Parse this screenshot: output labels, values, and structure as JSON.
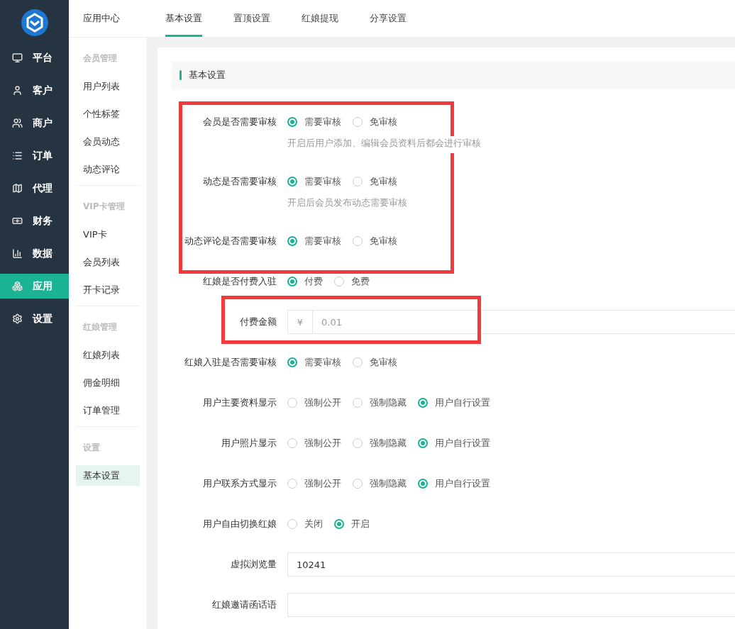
{
  "sidebar": {
    "items": [
      {
        "label": "平台",
        "selected": false
      },
      {
        "label": "客户",
        "selected": false
      },
      {
        "label": "商户",
        "selected": false
      },
      {
        "label": "订单",
        "selected": false
      },
      {
        "label": "代理",
        "selected": false
      },
      {
        "label": "财务",
        "selected": false
      },
      {
        "label": "数据",
        "selected": false
      },
      {
        "label": "应用",
        "selected": true
      },
      {
        "label": "设置",
        "selected": false
      }
    ]
  },
  "subnav": {
    "title": "应用中心",
    "sections": [
      {
        "title": "会员管理",
        "items": [
          {
            "label": "用户列表",
            "selected": false
          },
          {
            "label": "个性标签",
            "selected": false
          },
          {
            "label": "会员动态",
            "selected": false
          },
          {
            "label": "动态评论",
            "selected": false
          }
        ]
      },
      {
        "title": "VIP卡管理",
        "items": [
          {
            "label": "VIP卡",
            "selected": false
          },
          {
            "label": "会员列表",
            "selected": false
          },
          {
            "label": "开卡记录",
            "selected": false
          }
        ]
      },
      {
        "title": "红娘管理",
        "items": [
          {
            "label": "红娘列表",
            "selected": false
          },
          {
            "label": "佣金明细",
            "selected": false
          },
          {
            "label": "订单管理",
            "selected": false
          }
        ]
      },
      {
        "title": "设置",
        "items": [
          {
            "label": "基本设置",
            "selected": true
          }
        ]
      }
    ]
  },
  "tabs": [
    {
      "label": "基本设置",
      "selected": true
    },
    {
      "label": "置顶设置",
      "selected": false
    },
    {
      "label": "红娘提现",
      "selected": false
    },
    {
      "label": "分享设置",
      "selected": false
    }
  ],
  "section_title": "基本设置",
  "form": {
    "groups": [
      {
        "highlighted": true,
        "fields": [
          {
            "kind": "radio",
            "label": "会员是否需要审核",
            "options": [
              {
                "label": "需要审核",
                "selected": true
              },
              {
                "label": "免审核",
                "selected": false
              }
            ],
            "hint": "开启后用户添加、编辑会员资料后都会进行审核"
          },
          {
            "kind": "radio",
            "label": "动态是否需要审核",
            "options": [
              {
                "label": "需要审核",
                "selected": true
              },
              {
                "label": "免审核",
                "selected": false
              }
            ],
            "hint": "开启后会员发布动态需要审核"
          },
          {
            "kind": "radio",
            "label": "动态评论是否需要审核",
            "options": [
              {
                "label": "需要审核",
                "selected": true
              },
              {
                "label": "免审核",
                "selected": false
              }
            ]
          }
        ]
      },
      {
        "highlighted": false,
        "fields": [
          {
            "kind": "radio",
            "label": "红娘是否付费入驻",
            "options": [
              {
                "label": "付费",
                "selected": true
              },
              {
                "label": "免费",
                "selected": false
              }
            ]
          }
        ]
      },
      {
        "highlighted": true,
        "fields": [
          {
            "kind": "input",
            "label": "付费金额",
            "prefix": "¥",
            "placeholder": "0.01"
          }
        ]
      },
      {
        "highlighted": false,
        "fields": [
          {
            "kind": "radio",
            "label": "红娘入驻是否需要审核",
            "options": [
              {
                "label": "需要审核",
                "selected": true
              },
              {
                "label": "免审核",
                "selected": false
              }
            ]
          },
          {
            "kind": "radio",
            "label": "用户主要资料显示",
            "options": [
              {
                "label": "强制公开",
                "selected": false
              },
              {
                "label": "强制隐藏",
                "selected": false
              },
              {
                "label": "用户自行设置",
                "selected": true
              }
            ]
          },
          {
            "kind": "radio",
            "label": "用户照片显示",
            "options": [
              {
                "label": "强制公开",
                "selected": false
              },
              {
                "label": "强制隐藏",
                "selected": false
              },
              {
                "label": "用户自行设置",
                "selected": true
              }
            ]
          },
          {
            "kind": "radio",
            "label": "用户联系方式显示",
            "options": [
              {
                "label": "强制公开",
                "selected": false
              },
              {
                "label": "强制隐藏",
                "selected": false
              },
              {
                "label": "用户自行设置",
                "selected": true
              }
            ]
          },
          {
            "kind": "radio",
            "label": "用户自由切换红娘",
            "options": [
              {
                "label": "关闭",
                "selected": false
              },
              {
                "label": "开启",
                "selected": true
              }
            ]
          },
          {
            "kind": "input",
            "label": "虚拟浏览量",
            "value": "10241"
          },
          {
            "kind": "input",
            "label": "红娘邀请函话语"
          }
        ]
      }
    ]
  }
}
